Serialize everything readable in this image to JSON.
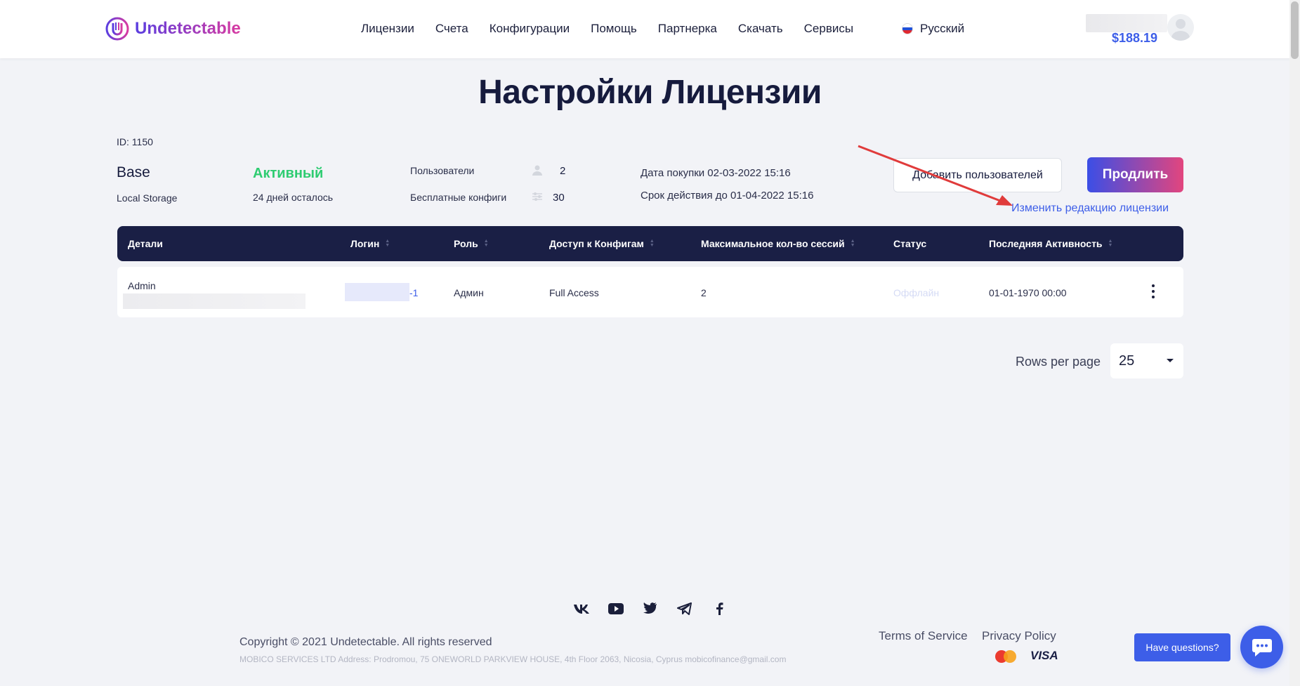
{
  "header": {
    "logo_text": "Undetectable",
    "nav": [
      "Лицензии",
      "Счета",
      "Конфигурации",
      "Помощь",
      "Партнерка",
      "Скачать",
      "Сервисы"
    ],
    "language": "Русский",
    "balance": "$188.19"
  },
  "page": {
    "title": "Настройки Лицензии"
  },
  "license": {
    "id": "ID: 1150",
    "plan": "Base",
    "storage": "Local Storage",
    "status": "Активный",
    "days_left": "24 дней осталось",
    "users_label": "Пользователи",
    "users_value": "2",
    "configs_label": "Бесплатные конфиги",
    "configs_value": "30",
    "purchase_date": "Дата покупки 02-03-2022 15:16",
    "valid_until": "Срок действия до 01-04-2022 15:16",
    "add_users_label": "Добавить пользователей",
    "renew_label": "Продлить",
    "edit_link": "Изменить редакцию лицензии"
  },
  "table": {
    "columns": [
      "Детали",
      "Логин",
      "Роль",
      "Доступ к Конфигам",
      "Максимальное кол-во сессий",
      "Статус",
      "Последняя Активность"
    ],
    "rows": [
      {
        "details": "Admin",
        "login_suffix": "-1",
        "role": "Админ",
        "access": "Full Access",
        "max_sessions": "2",
        "status": "Оффлайн",
        "last_activity": "01-01-1970 00:00"
      }
    ],
    "rows_per_page_label": "Rows per page",
    "rows_per_page": "25"
  },
  "footer": {
    "copyright": "Copyright © 2021 Undetectable. All rights reserved",
    "address": "MOBICO SERVICES LTD Address: Prodromou, 75 ONEWORLD PARKVIEW HOUSE, 4th Floor 2063, Nicosia, Cyprus mobicofinance@gmail.com",
    "terms": "Terms of Service",
    "privacy": "Privacy Policy",
    "visa": "VISA",
    "have_questions": "Have questions?"
  },
  "colors": {
    "accent": "#3d5ee8",
    "active_green": "#2ecc71",
    "table_header": "#1a1f45",
    "background": "#f2f3f7"
  }
}
